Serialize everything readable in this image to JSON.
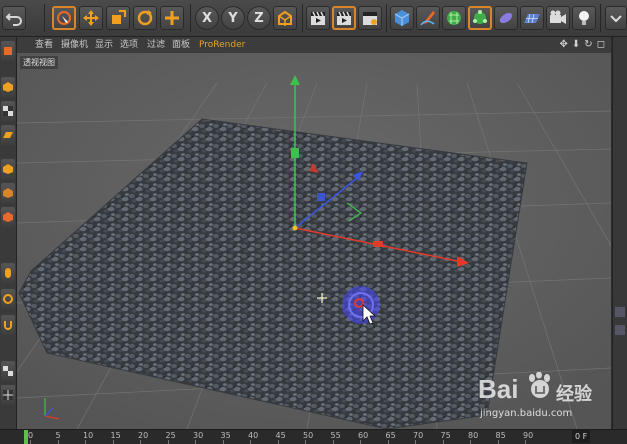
{
  "viewport": {
    "menus": [
      "查看",
      "摄像机",
      "显示",
      "选项",
      "过滤",
      "面板",
      "ProRender"
    ],
    "view_label": "透视视图",
    "nav_icons": [
      "move-view-icon",
      "zoom-view-icon",
      "rotate-view-icon",
      "maximize-view-icon"
    ]
  },
  "toolbar": {
    "axis_x": "X",
    "axis_y": "Y",
    "axis_z": "Z"
  },
  "timeline": {
    "ticks": [
      "0",
      "5",
      "10",
      "15",
      "20",
      "25",
      "30",
      "35",
      "40",
      "45",
      "50",
      "55",
      "60",
      "65",
      "70",
      "75",
      "80",
      "85",
      "90"
    ],
    "current_frame": "0 F"
  },
  "watermark": {
    "logo_text": "Bai",
    "logo_text2": "经验",
    "url": "jingyan.baidu.com"
  },
  "colors": {
    "accent": "#d9862b",
    "axis_x": "#e33a2a",
    "axis_y": "#3cc24a",
    "axis_z": "#3b55e0",
    "prorender": "#e9a12a"
  }
}
